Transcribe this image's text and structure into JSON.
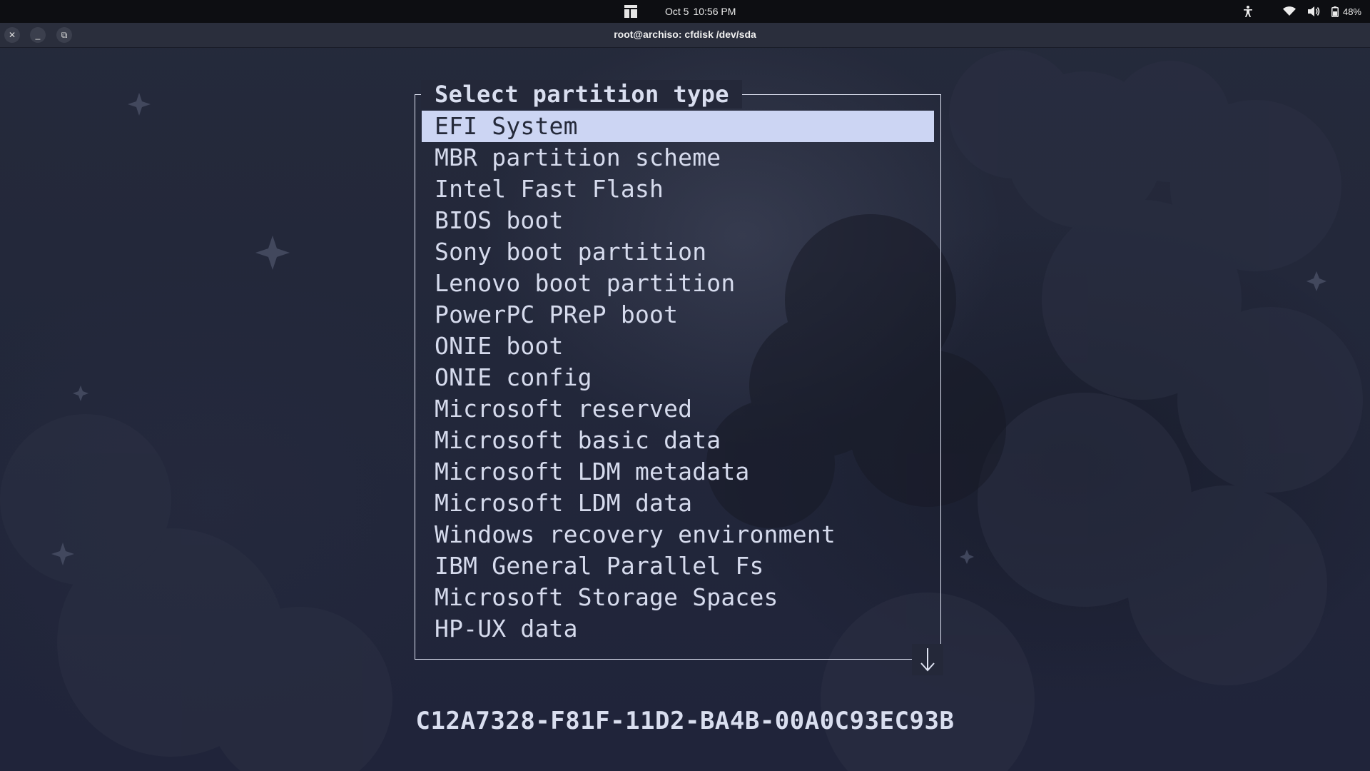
{
  "top_bar": {
    "date": "Oct 5",
    "time": "10:56 PM",
    "battery_percent": "48%",
    "icons": [
      "activities-icon",
      "accessibility-icon",
      "wifi-icon",
      "volume-icon",
      "battery-icon"
    ]
  },
  "window": {
    "title": "root@archiso: cfdisk /dev/sda",
    "buttons": {
      "close": "✕",
      "minimize": "_",
      "maximize": "⧉"
    }
  },
  "dialog": {
    "title": "Select partition type",
    "selected_index": 0,
    "items": [
      "EFI System",
      "MBR partition scheme",
      "Intel Fast Flash",
      "BIOS boot",
      "Sony boot partition",
      "Lenovo boot partition",
      "PowerPC PReP boot",
      "ONIE boot",
      "ONIE config",
      "Microsoft reserved",
      "Microsoft basic data",
      "Microsoft LDM metadata",
      "Microsoft LDM data",
      "Windows recovery environment",
      "IBM General Parallel Fs",
      "Microsoft Storage Spaces",
      "HP-UX data"
    ],
    "more_below_icon": "arrow-down-icon"
  },
  "type_guid": "C12A7328-F81F-11D2-BA4B-00A0C93EC93B",
  "colors": {
    "background": "#22273a",
    "top_bar": "#0d0e12",
    "title_bar": "#2a2e3c",
    "text": "#d6dbed",
    "highlight_bg": "#ccd5f3",
    "highlight_fg": "#252a3a",
    "border": "#dfe3f2"
  }
}
